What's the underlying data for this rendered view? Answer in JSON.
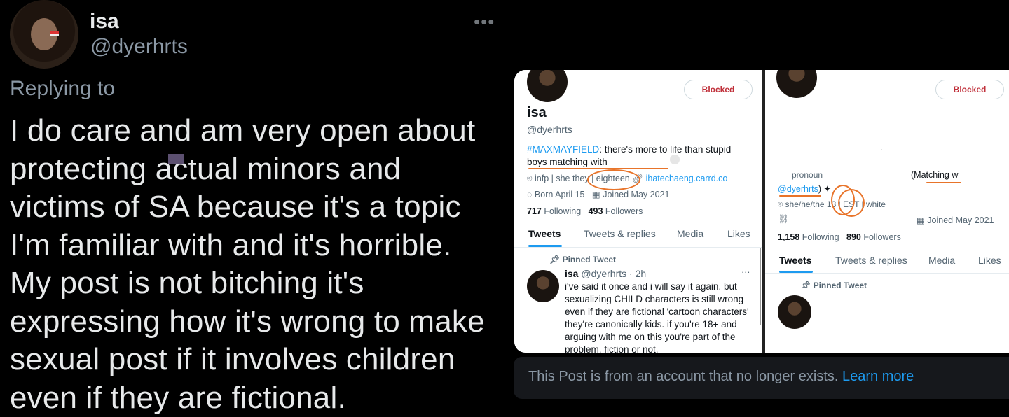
{
  "tweet": {
    "author_name": "isa",
    "author_handle": "@dyerhrts",
    "more_icon": "ellipsis-icon",
    "replying_label": "Replying to",
    "body": "I do care and am very open about protecting actual minors and victims of SA because it's a topic I'm familiar with and it's horrible. My post is not bitching it's expressing how it's wrong to make sexual post if it involves children even if they are fictional."
  },
  "screenshot_left": {
    "blocked_label": "Blocked",
    "name": "isa",
    "handle": "@dyerhrts",
    "bio_hashtag": "#MAXMAYFIELD",
    "bio_text": ": there's more to life than stupid",
    "bio_line2": "boys matching with",
    "meta_line1_text": "infp | she they | eighteen",
    "meta_link": "ihatechaeng.carrd.co",
    "born": "Born April 15",
    "joined": "Joined May 2021",
    "following_count": "717",
    "following_label": "Following",
    "followers_count": "493",
    "followers_label": "Followers",
    "tabs": [
      "Tweets",
      "Tweets & replies",
      "Media",
      "Likes"
    ],
    "pinned_label": "Pinned Tweet",
    "tweet_name": "isa",
    "tweet_handle_time": "@dyerhrts · 2h",
    "tweet_body": "i've said it once and i will say it again. but sexualizing CHILD characters is still wrong even if they are fictional 'cartoon characters' they're canonically kids. if you're 18+ and arguing with me on this you're part of the problem. fiction or not."
  },
  "screenshot_right": {
    "blocked_label": "Blocked",
    "dash": "--",
    "dot": ".",
    "pronoun_fragment": "pronoun",
    "matching_label": "(Matching w",
    "handle_link": "@dyerhrts",
    "handle_suffix": ") ✦",
    "meta_line": "she/he/the   13 | EST | white",
    "joined": "Joined May 2021",
    "following_count": "1,158",
    "following_label": "Following",
    "followers_count": "890",
    "followers_label": "Followers",
    "tabs": [
      "Tweets",
      "Tweets & replies",
      "Media",
      "Likes"
    ],
    "pinned_label": "Pinned Tweet"
  },
  "notice": {
    "text": "This Post is from an account that no longer exists.",
    "link": "Learn more"
  },
  "colors": {
    "background": "#000000",
    "link_blue": "#1d9bf0",
    "muted_gray": "#8b98a5",
    "blocked_red": "#c0303a",
    "annotation_orange": "#e8742a"
  }
}
